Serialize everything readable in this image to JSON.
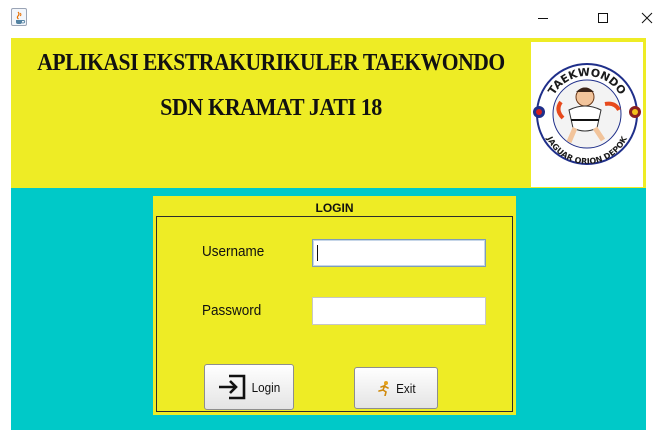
{
  "window": {
    "icon": "java-cup-icon",
    "controls": {
      "minimize": "minimize-icon",
      "maximize": "maximize-icon",
      "close": "close-icon"
    }
  },
  "header": {
    "title_line1": "APLIKASI EKSTRAKURIKULER TAEKWONDO",
    "title_line2": "SDN KRAMAT JATI 18",
    "logo": {
      "top_text": "TAEKWONDO",
      "bottom_text": "JAGUAR ORION DEPOK"
    }
  },
  "login": {
    "title": "LOGIN",
    "username_label": "Username",
    "username_value": "",
    "password_label": "Password",
    "password_value": "",
    "login_button": "Login",
    "login_icon": "enter-arrow-icon",
    "exit_button": "Exit",
    "exit_icon": "running-person-icon"
  },
  "colors": {
    "header_bg": "#eeec25",
    "main_bg": "#00c9c8",
    "login_bg": "#eeec25"
  }
}
